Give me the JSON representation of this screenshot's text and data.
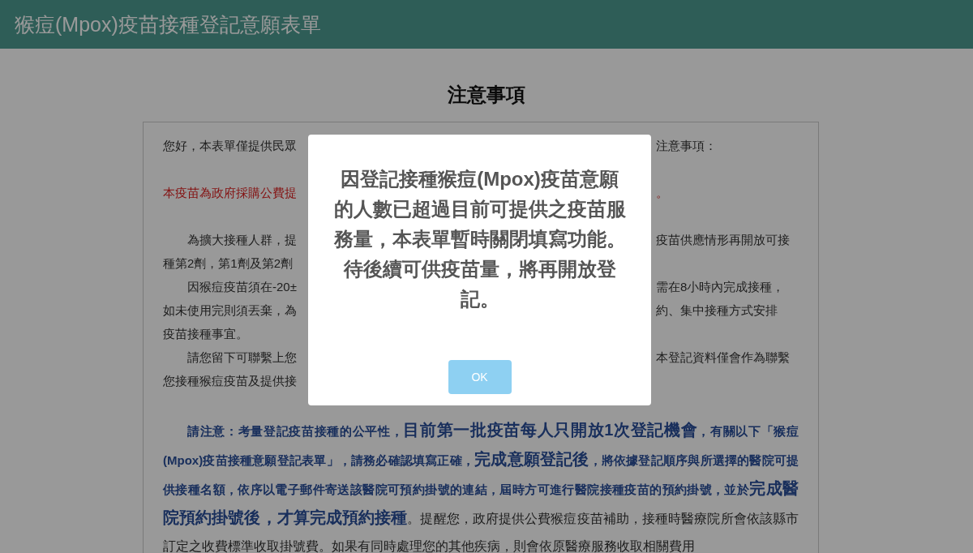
{
  "header": {
    "title": "猴痘(Mpox)疫苗接種登記意願表單"
  },
  "notice": {
    "heading": "注意事項",
    "blocks": [
      {
        "lines": [
          {
            "kind": "plain",
            "indent": false,
            "left": "您好，本表單僅提供民眾",
            "right": "注意事項："
          }
        ]
      },
      {
        "lines": [
          {
            "kind": "warning",
            "indent": false,
            "left": "本疫苗為政府採購公費提",
            "right": "。"
          }
        ]
      },
      {
        "lines": [
          {
            "kind": "plain",
            "indent": true,
            "left": "為擴大接種人群，提",
            "right": "疫苗供應情形再開放可接"
          },
          {
            "kind": "plain",
            "indent": false,
            "left": "種第2劑，第1劑及第2劑"
          },
          {
            "kind": "plain",
            "indent": true,
            "left": "因猴痘疫苗須在-20±",
            "right": "需在8小時內完成接種，"
          },
          {
            "kind": "plain",
            "indent": false,
            "left": "如未使用完則須丟棄，為",
            "right": "約、集中接種方式安排"
          },
          {
            "kind": "plain",
            "indent": false,
            "left": "疫苗接種事宜。"
          },
          {
            "kind": "plain",
            "indent": true,
            "left": "請您留下可聯繫上您",
            "right": "本登記資料僅會作為聯繫"
          },
          {
            "kind": "plain",
            "indent": false,
            "left": "您接種猴痘疫苗及提供接"
          }
        ]
      }
    ],
    "paragraph": [
      {
        "kind": "note",
        "text": "請注意：考量登記疫苗接種的公平性，"
      },
      {
        "kind": "highlight",
        "text": "目前第一批疫苗每人只開放1次登記機會"
      },
      {
        "kind": "note",
        "text": "，有關以下「猴痘(Mpox)疫苗接種意願登記表單」，請務必確認填寫正確，"
      },
      {
        "kind": "highlight",
        "text": "完成意願登記後"
      },
      {
        "kind": "note",
        "text": "，將依據登記順序與所選擇的醫院可提供接種名額，依序以電子郵件寄送該醫院可預約掛號的連結，屆時方可進行醫院接種疫苗的預約掛號，並於"
      },
      {
        "kind": "highlight",
        "text": "完成醫院預約掛號後，才算完成預約接種"
      },
      {
        "kind": "plain",
        "text": "。提醒您，政府提供公費猴痘疫苗補助，接種時醫療院所會依該縣市訂定之收費標準收取掛號費。如果有同時處理您的其他疾病，則會依原醫療服務收取相關費用"
      }
    ]
  },
  "dialog": {
    "message": "因登記接種猴痘(Mpox)疫苗意願的人數已超過目前可提供之疫苗服務量，本表單暫時關閉填寫功能。待後續可供疫苗量，將再開放登記。",
    "button": "OK"
  }
}
